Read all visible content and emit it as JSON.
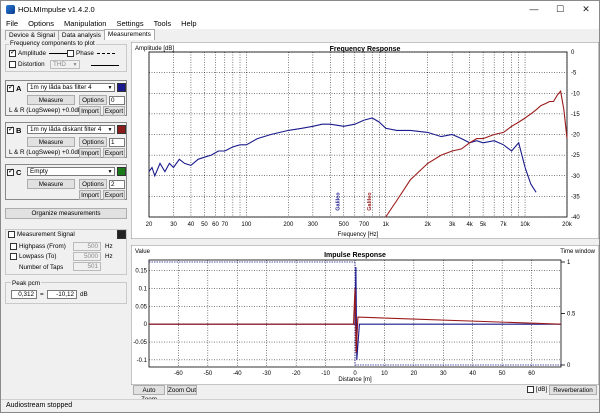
{
  "window": {
    "title": "HOLMImpulse   v1.4.2.0",
    "minimize": "—",
    "maximize": "☐",
    "close": "✕"
  },
  "menu": [
    "File",
    "Options",
    "Manipulation",
    "Settings",
    "Tools",
    "Help"
  ],
  "tabs": [
    "Device & Signal",
    "Data analysis",
    "Measurements"
  ],
  "left": {
    "freq_components_label": "Frequency components to plot",
    "amplitude_label": "Amplitude",
    "phase_label": "Phase",
    "distortion_label": "Distortion",
    "distortion_value": "THD",
    "measurements": [
      {
        "letter": "A",
        "name": "1m ny låda bas filter 4",
        "measure": "Measure",
        "options": "Options",
        "spin": "0",
        "info": "L & R (LogSweep) +0.0dB",
        "import": "Import",
        "export": "Export",
        "color": "#1a1a8c"
      },
      {
        "letter": "B",
        "name": "1m ny låda diskant filter 4",
        "measure": "Measure",
        "options": "Options",
        "spin": "1",
        "info": "L & R (LogSweep) +0.0dB",
        "import": "Import",
        "export": "Export",
        "color": "#8b1a1a"
      },
      {
        "letter": "C",
        "name": "Empty",
        "measure": "Measure",
        "options": "Options",
        "spin": "2",
        "info": "",
        "import": "Import",
        "export": "Export",
        "color": "#1a7a1a"
      }
    ],
    "organize": "Organize measurements",
    "meas_signal_label": "Measurement Signal",
    "highpass_label": "Highpass (From)",
    "highpass_value": "500",
    "lowpass_label": "Lowpass (To)",
    "lowpass_value": "5000",
    "taps_label": "Number of Taps",
    "taps_value": "501",
    "hz": "Hz",
    "peak_label": "Peak pcm",
    "peak_value1": "0,312",
    "peak_eq": "=",
    "peak_value2": "-10,12",
    "peak_unit": "dB"
  },
  "freq_chart": {
    "title": "Frequency Response",
    "ylabel": "Amplitude [dB]",
    "xlabel": "Frequency [Hz]",
    "y_ticks": [
      "0",
      "-5",
      "-10",
      "-15",
      "-20",
      "-25",
      "-30",
      "-35",
      "-40"
    ],
    "x_ticks": [
      "20",
      "30",
      "40",
      "50",
      "60",
      "70",
      "100",
      "200",
      "300",
      "500",
      "700",
      "1k",
      "2k",
      "3k",
      "4k",
      "5k",
      "7k",
      "10k",
      "20k"
    ],
    "annot1": "Galileo",
    "annot2": "Galileo",
    "colors": {
      "bg": "#ffffff",
      "grid": "#000000",
      "series_a": "#1a1a8c",
      "series_b": "#9b1b1b"
    }
  },
  "chart_data": [
    {
      "type": "line",
      "title": "Frequency Response",
      "xlabel": "Frequency [Hz]",
      "ylabel": "Amplitude [dB]",
      "x_scale": "log",
      "xlim": [
        20,
        20000
      ],
      "ylim": [
        -40,
        0
      ],
      "grid": true,
      "series": [
        {
          "name": "",
          "color": "#1a1a8c",
          "x": [
            20,
            21,
            22,
            24,
            26,
            28,
            30,
            33,
            36,
            40,
            45,
            50,
            56,
            63,
            70,
            80,
            90,
            100,
            120,
            150,
            200,
            250,
            300,
            350,
            400,
            500,
            600,
            700,
            800,
            900,
            1000,
            1200,
            1500,
            2000,
            2500,
            3000,
            3500,
            4000,
            4500,
            5000,
            6000,
            7000,
            8000,
            9000,
            10000,
            11000,
            12000
          ],
          "y": [
            -29,
            -28,
            -30,
            -27,
            -29,
            -27,
            -28,
            -26,
            -27,
            -27.5,
            -26,
            -25.5,
            -25,
            -24,
            -24,
            -23,
            -22.5,
            -22.5,
            -21,
            -20,
            -19,
            -18.5,
            -18,
            -17.5,
            -17.5,
            -18,
            -17.5,
            -16.5,
            -16,
            -17,
            -18.5,
            -19,
            -19,
            -19.5,
            -20.5,
            -20,
            -21,
            -22,
            -21.5,
            -22,
            -21.5,
            -22.5,
            -24,
            -22,
            -28,
            -32,
            -34
          ]
        },
        {
          "name": "",
          "color": "#9b1b1b",
          "x": [
            1000,
            1200,
            1500,
            2000,
            2500,
            3000,
            3500,
            4000,
            4500,
            5000,
            6000,
            7000,
            8000,
            9000,
            10000,
            11000,
            12000,
            13000,
            14000,
            15000,
            16000,
            17000,
            18000,
            19000,
            20000
          ],
          "y": [
            -40,
            -36,
            -31,
            -27,
            -25,
            -24,
            -23.5,
            -22,
            -21,
            -21,
            -20,
            -19.5,
            -18,
            -17,
            -16,
            -15,
            -14,
            -13,
            -12.5,
            -12,
            -12,
            -10.5,
            -9.5,
            -14,
            -21
          ]
        }
      ]
    },
    {
      "type": "line",
      "title": "Impulse Response",
      "xlabel": "Distance [m]",
      "ylabel": "Value",
      "y2label": "Time window",
      "xlim": [
        -70,
        70
      ],
      "ylim": [
        -0.12,
        0.18
      ],
      "grid": true,
      "series": [
        {
          "name": "",
          "color": "#1a1a8c",
          "x": [
            -70,
            0,
            0.3,
            0.6,
            1.5,
            70
          ],
          "y": [
            0,
            0,
            0.16,
            -0.1,
            0,
            0
          ]
        },
        {
          "name": "",
          "color": "#9b1b1b",
          "x": [
            -70,
            -0.5,
            0,
            0.4,
            1,
            70
          ],
          "y": [
            0,
            0,
            0.1,
            -0.08,
            0.02,
            0
          ]
        }
      ]
    }
  ],
  "imp_chart": {
    "title": "Impulse Response",
    "ylabel": "Value",
    "y2label": "Time window",
    "xlabel": "Distance [m]",
    "y_ticks": [
      "0.15",
      "0.1",
      "0.05",
      "0",
      "-0.05",
      "-0.1"
    ],
    "y2_ticks": [
      "1",
      "0.5",
      "0"
    ],
    "x_ticks": [
      "-60",
      "-50",
      "-40",
      "-30",
      "-20",
      "-10",
      "0",
      "10",
      "20",
      "30",
      "40",
      "50",
      "60"
    ],
    "auto_zoom": "Auto Zoom",
    "zoom_out": "Zoom Out",
    "db_label": "[dB]",
    "reverb": "Reverberation"
  },
  "status": "Audiostream stopped"
}
